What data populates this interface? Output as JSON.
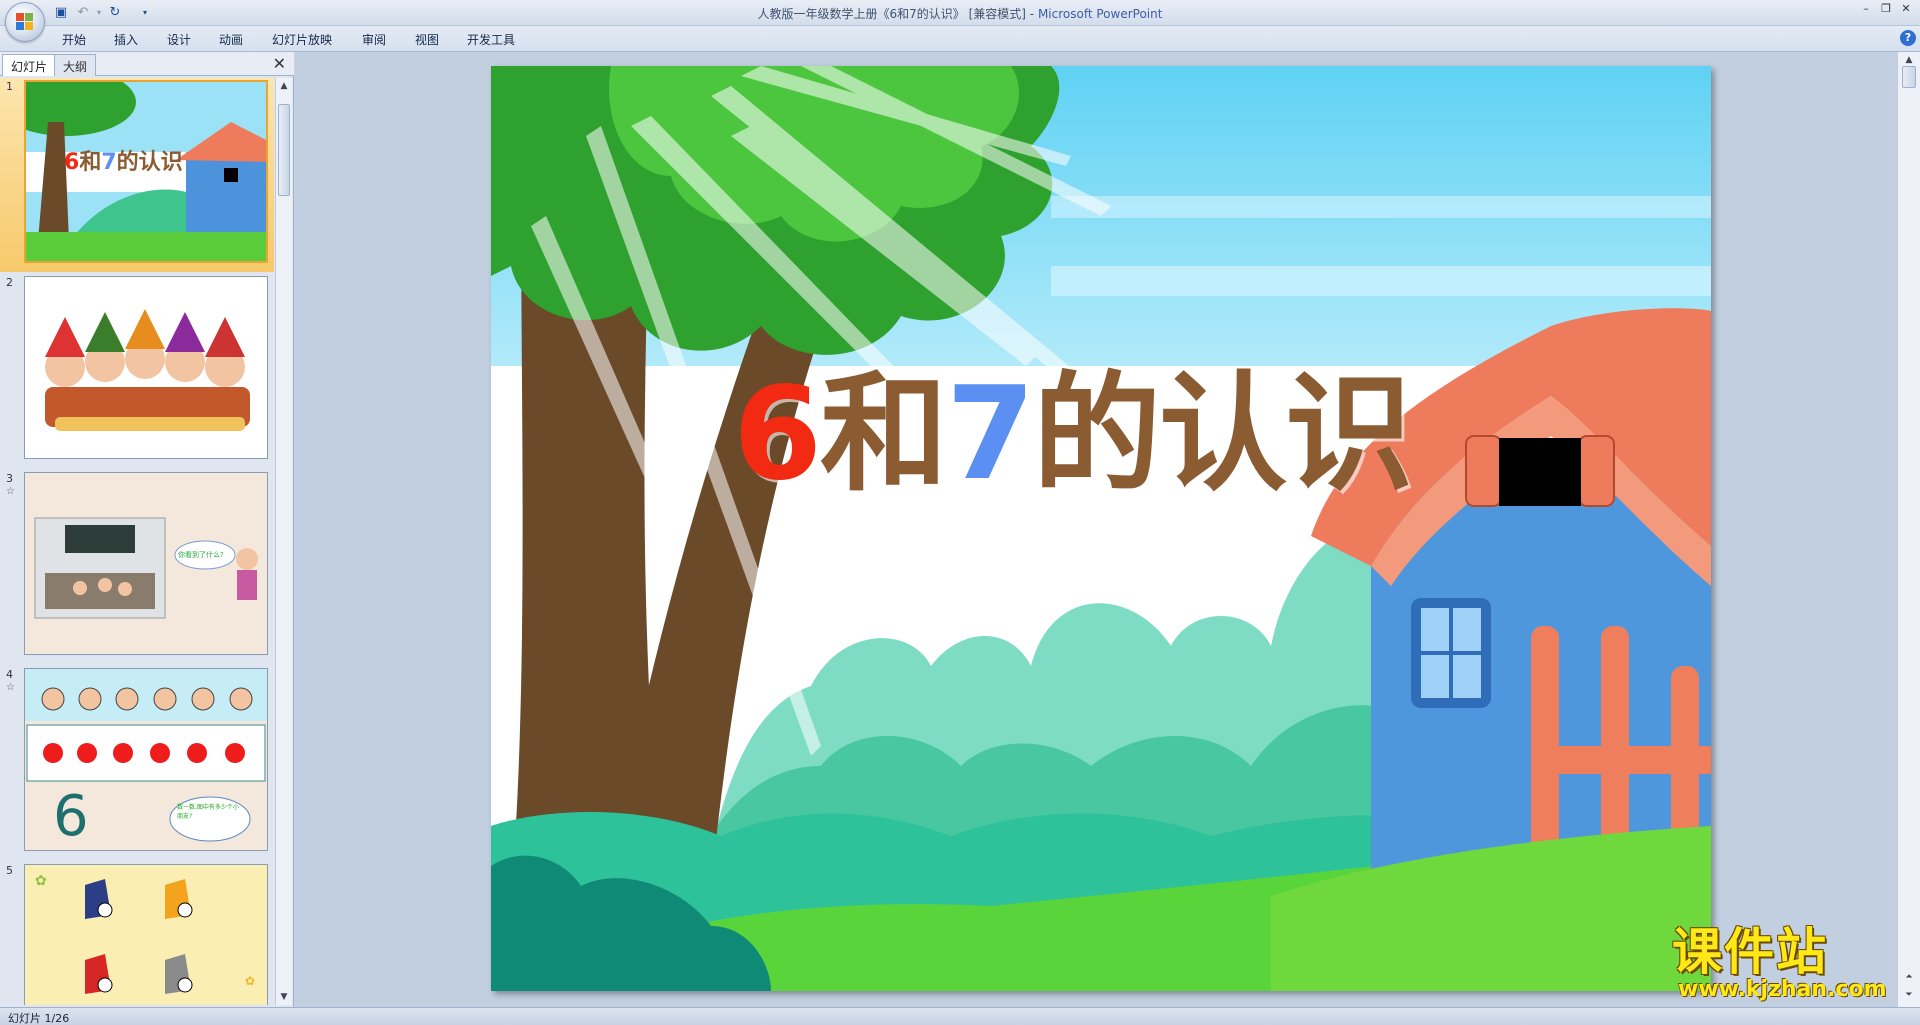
{
  "window": {
    "title_doc": "人教版一年级数学上册《6和7的认识》 [兼容模式] - ",
    "title_app": "Microsoft PowerPoint"
  },
  "quick_access": {
    "save_icon": "save-icon",
    "undo_icon": "undo-icon",
    "redo_icon": "redo-icon"
  },
  "ribbon": {
    "tabs": [
      "开始",
      "插入",
      "设计",
      "动画",
      "幻灯片放映",
      "审阅",
      "视图",
      "开发工具"
    ]
  },
  "left_pane": {
    "tabs": [
      "幻灯片",
      "大纲"
    ],
    "thumbnails": [
      {
        "number": "1",
        "title": "6和7的认识",
        "selected": true
      },
      {
        "number": "2"
      },
      {
        "number": "3",
        "bubble": "你看到了什么?"
      },
      {
        "number": "4",
        "digit": "6",
        "bubble": "数一数,图中有多少个小朋友?"
      },
      {
        "number": "5"
      }
    ]
  },
  "slide": {
    "title_part1": "6",
    "title_part2": "和",
    "title_part3": "7",
    "title_part4": "的认识"
  },
  "watermark": {
    "big": "课件站",
    "url": "www.kjzhan.com"
  },
  "status": {
    "slide_counter": "幻灯片 1/26"
  },
  "colors": {
    "accent_orange": "#f7c96b",
    "title_six": "#f22a12",
    "title_seven": "#5b8ff2",
    "title_brown": "#8b5b32"
  }
}
